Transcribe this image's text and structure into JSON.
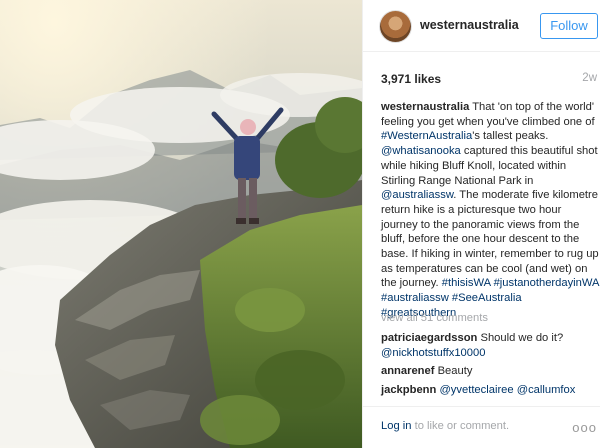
{
  "photo": {
    "alt_icon": "landscape-photo"
  },
  "header": {
    "username": "westernaustralia",
    "follow_label": "Follow"
  },
  "stats": {
    "likes": "3,971 likes",
    "age": "2w"
  },
  "caption": {
    "user": "westernaustralia",
    "t1": " That 'on top of the world' feeling you get when you've climbed one of ",
    "l1": "#WesternAustralia",
    "t2": "'s tallest peaks. ",
    "l2": "@whatisanooka",
    "t3": " captured this beautiful shot while hiking Bluff Knoll, located within Stirling Range National Park in ",
    "l3": "@australiassw",
    "t4": ". The moderate five kilometre return hike is a picturesque two hour journey to the panoramic views from the bluff, before the one hour descent to the base. If hiking in winter, remember to rug up as temperatures can be cool (and wet) on the journey. ",
    "l4": "#thisisWA",
    "l5": "#justanotherdayinWA",
    "l6": "#australiassw",
    "l7": "#SeeAustralia",
    "l8": "#greatsouthern"
  },
  "comments": {
    "view_all": "view all 51 comments",
    "c1_user": "patriciaegardsson",
    "c1_text": " Should we do it?",
    "c1_link": "@nickhotstuffx10000",
    "c2_user": "annarenef",
    "c2_text": " Beauty",
    "c3_user": "jackpbenn",
    "c3_link1": "@yvetteclairee",
    "c3_link2": "@callumfox"
  },
  "footer": {
    "login": "Log in",
    "rest": " to like or comment.",
    "more_icon": "ellipsis-icon",
    "more_glyph": "ooo"
  },
  "colors": {
    "link": "#003569",
    "follow": "#3897f0",
    "muted": "#a5a7aa",
    "text": "#262626"
  }
}
